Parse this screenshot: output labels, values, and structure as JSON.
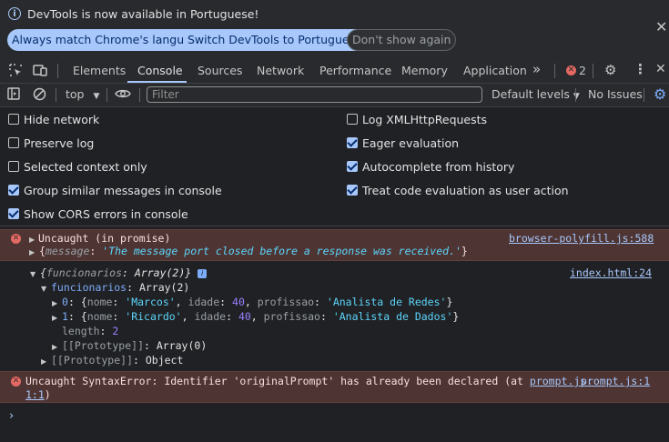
{
  "infobar": {
    "message": "DevTools is now available in Portuguese!",
    "buttons": [
      "Always match Chrome's language",
      "Switch DevTools to Portuguese",
      "Don't show again"
    ]
  },
  "tabs": [
    "Elements",
    "Console",
    "Sources",
    "Network",
    "Performance",
    "Memory",
    "Application"
  ],
  "active_tab": "Console",
  "more_tabs_glyph": "»",
  "error_count": "2",
  "toolbar": {
    "context": "top",
    "filter_placeholder": "Filter",
    "levels": "Default levels",
    "issues": "No Issues"
  },
  "settings": [
    {
      "label": "Hide network",
      "checked": false
    },
    {
      "label": "Preserve log",
      "checked": false
    },
    {
      "label": "Selected context only",
      "checked": false
    },
    {
      "label": "Group similar messages in console",
      "checked": true
    },
    {
      "label": "Show CORS errors in console",
      "checked": true
    },
    {
      "label": "Log XMLHttpRequests",
      "checked": false
    },
    {
      "label": "Eager evaluation",
      "checked": true
    },
    {
      "label": "Autocomplete from history",
      "checked": true
    },
    {
      "label": "Treat code evaluation as user action",
      "checked": true
    }
  ],
  "messages": {
    "err1": {
      "title": "Uncaught (in promise)",
      "source": "browser-polyfill.js:588",
      "detail_open": "{",
      "detail_key": "message",
      "detail_sep": ": ",
      "detail_val": "'The message port closed before a response was received.'",
      "detail_close": "}"
    },
    "log": {
      "summary_open": "{",
      "summary_key": "funcionarios",
      "summary_val": ": Array(2)}",
      "source": "index.html:24",
      "prop": "funcionarios",
      "prop_val": ": Array(2)",
      "item0_idx": "0",
      "item0": [
        {
          "t": ": {",
          "c": "obj"
        },
        {
          "t": "nome",
          "c": "key"
        },
        {
          "t": ": ",
          "c": "obj"
        },
        {
          "t": "'Marcos'",
          "c": "str"
        },
        {
          "t": ", ",
          "c": "obj"
        },
        {
          "t": "idade",
          "c": "key"
        },
        {
          "t": ": ",
          "c": "obj"
        },
        {
          "t": "40",
          "c": "num"
        },
        {
          "t": ", ",
          "c": "obj"
        },
        {
          "t": "profissao",
          "c": "key"
        },
        {
          "t": ": ",
          "c": "obj"
        },
        {
          "t": "'Analista de Redes'",
          "c": "str"
        },
        {
          "t": "}",
          "c": "obj"
        }
      ],
      "item1_idx": "1",
      "item1": [
        {
          "t": ": {",
          "c": "obj"
        },
        {
          "t": "nome",
          "c": "key"
        },
        {
          "t": ": ",
          "c": "obj"
        },
        {
          "t": "'Ricardo'",
          "c": "str"
        },
        {
          "t": ", ",
          "c": "obj"
        },
        {
          "t": "idade",
          "c": "key"
        },
        {
          "t": ": ",
          "c": "obj"
        },
        {
          "t": "40",
          "c": "num"
        },
        {
          "t": ", ",
          "c": "obj"
        },
        {
          "t": "profissao",
          "c": "key"
        },
        {
          "t": ": ",
          "c": "obj"
        },
        {
          "t": "'Analista de Dados'",
          "c": "str"
        },
        {
          "t": "}",
          "c": "obj"
        }
      ],
      "length_key": "length",
      "length_val": "2",
      "proto_array_key": "[[Prototype]]",
      "proto_array_val": ": Array(0)",
      "proto_obj_key": "[[Prototype]]",
      "proto_obj_val": ": Object"
    },
    "err2": {
      "text": "Uncaught SyntaxError: Identifier 'originalPrompt' has already been declared (at ",
      "link_a": "prompt.js:",
      "link_a2": "1:1",
      "close": ")",
      "source": "prompt.js:1"
    }
  },
  "prompt_glyph": "›"
}
